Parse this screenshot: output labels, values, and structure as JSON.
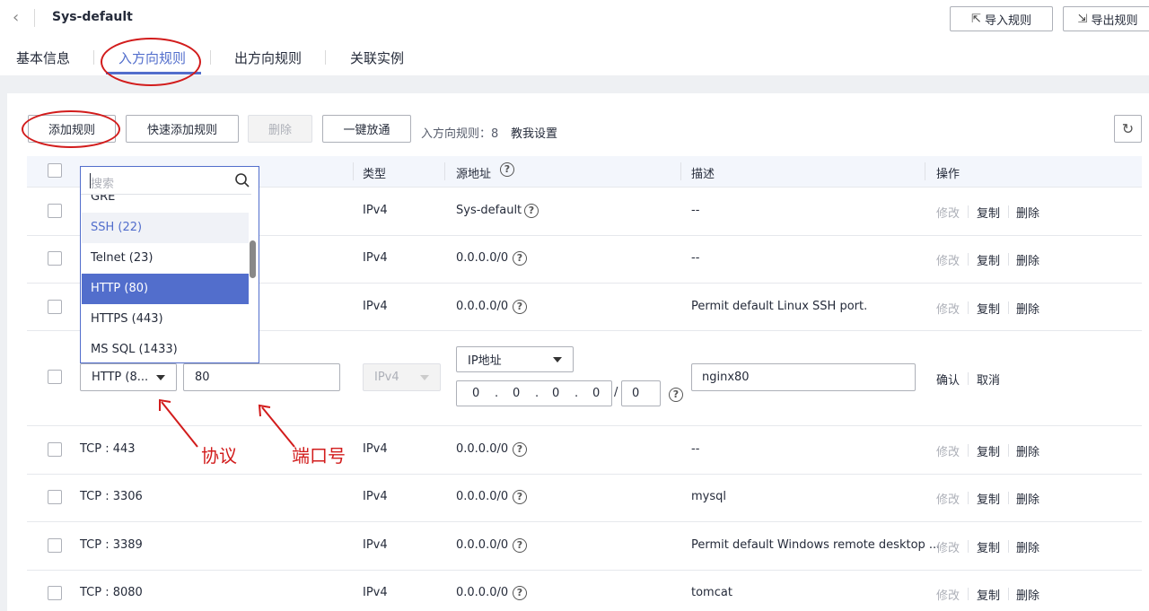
{
  "header": {
    "title": "Sys-default",
    "import_btn": "导入规则",
    "export_btn": "导出规则"
  },
  "tabs": [
    "基本信息",
    "入方向规则",
    "出方向规则",
    "关联实例"
  ],
  "toolbar": {
    "add_rule": "添加规则",
    "quick_add": "快速添加规则",
    "delete": "删除",
    "one_click": "一键放通",
    "count_label": "入方向规则：",
    "count": "8",
    "help_link": "教我设置"
  },
  "table": {
    "headers": [
      "类型",
      "源地址",
      "描述",
      "操作"
    ],
    "rows": [
      {
        "proto": "",
        "type": "IPv4",
        "source": "Sys-default",
        "desc": "--"
      },
      {
        "proto": "",
        "type": "IPv4",
        "source": "0.0.0.0/0",
        "desc": "--"
      },
      {
        "proto": "",
        "type": "IPv4",
        "source": "0.0.0.0/0",
        "desc": "Permit default Linux SSH port."
      }
    ],
    "rows_after": [
      {
        "proto": "TCP : 443",
        "type": "IPv4",
        "source": "0.0.0.0/0",
        "desc": "--"
      },
      {
        "proto": "TCP : 3306",
        "type": "IPv4",
        "source": "0.0.0.0/0",
        "desc": "mysql"
      },
      {
        "proto": "TCP : 3389",
        "type": "IPv4",
        "source": "0.0.0.0/0",
        "desc": "Permit default Windows remote desktop ..."
      },
      {
        "proto": "TCP : 8080",
        "type": "IPv4",
        "source": "0.0.0.0/0",
        "desc": "tomcat"
      }
    ],
    "ops": {
      "modify": "修改",
      "copy": "复制",
      "delete": "删除"
    }
  },
  "edit_row": {
    "protocol_value": "HTTP (8...",
    "port_value": "80",
    "type_value": "IPv4",
    "source_type": "IP地址",
    "ip": [
      "0",
      "0",
      "0",
      "0"
    ],
    "mask": "0",
    "desc_value": "nginx80",
    "confirm": "确认",
    "cancel": "取消"
  },
  "dropdown": {
    "search_placeholder": "搜索",
    "items": [
      "GRE",
      "SSH (22)",
      "Telnet (23)",
      "HTTP (80)",
      "HTTPS (443)",
      "MS SQL (1433)"
    ],
    "selected": "HTTP (80)",
    "hovered": "SSH (22)"
  },
  "annotations": {
    "protocol": "协议",
    "port": "端口号"
  }
}
